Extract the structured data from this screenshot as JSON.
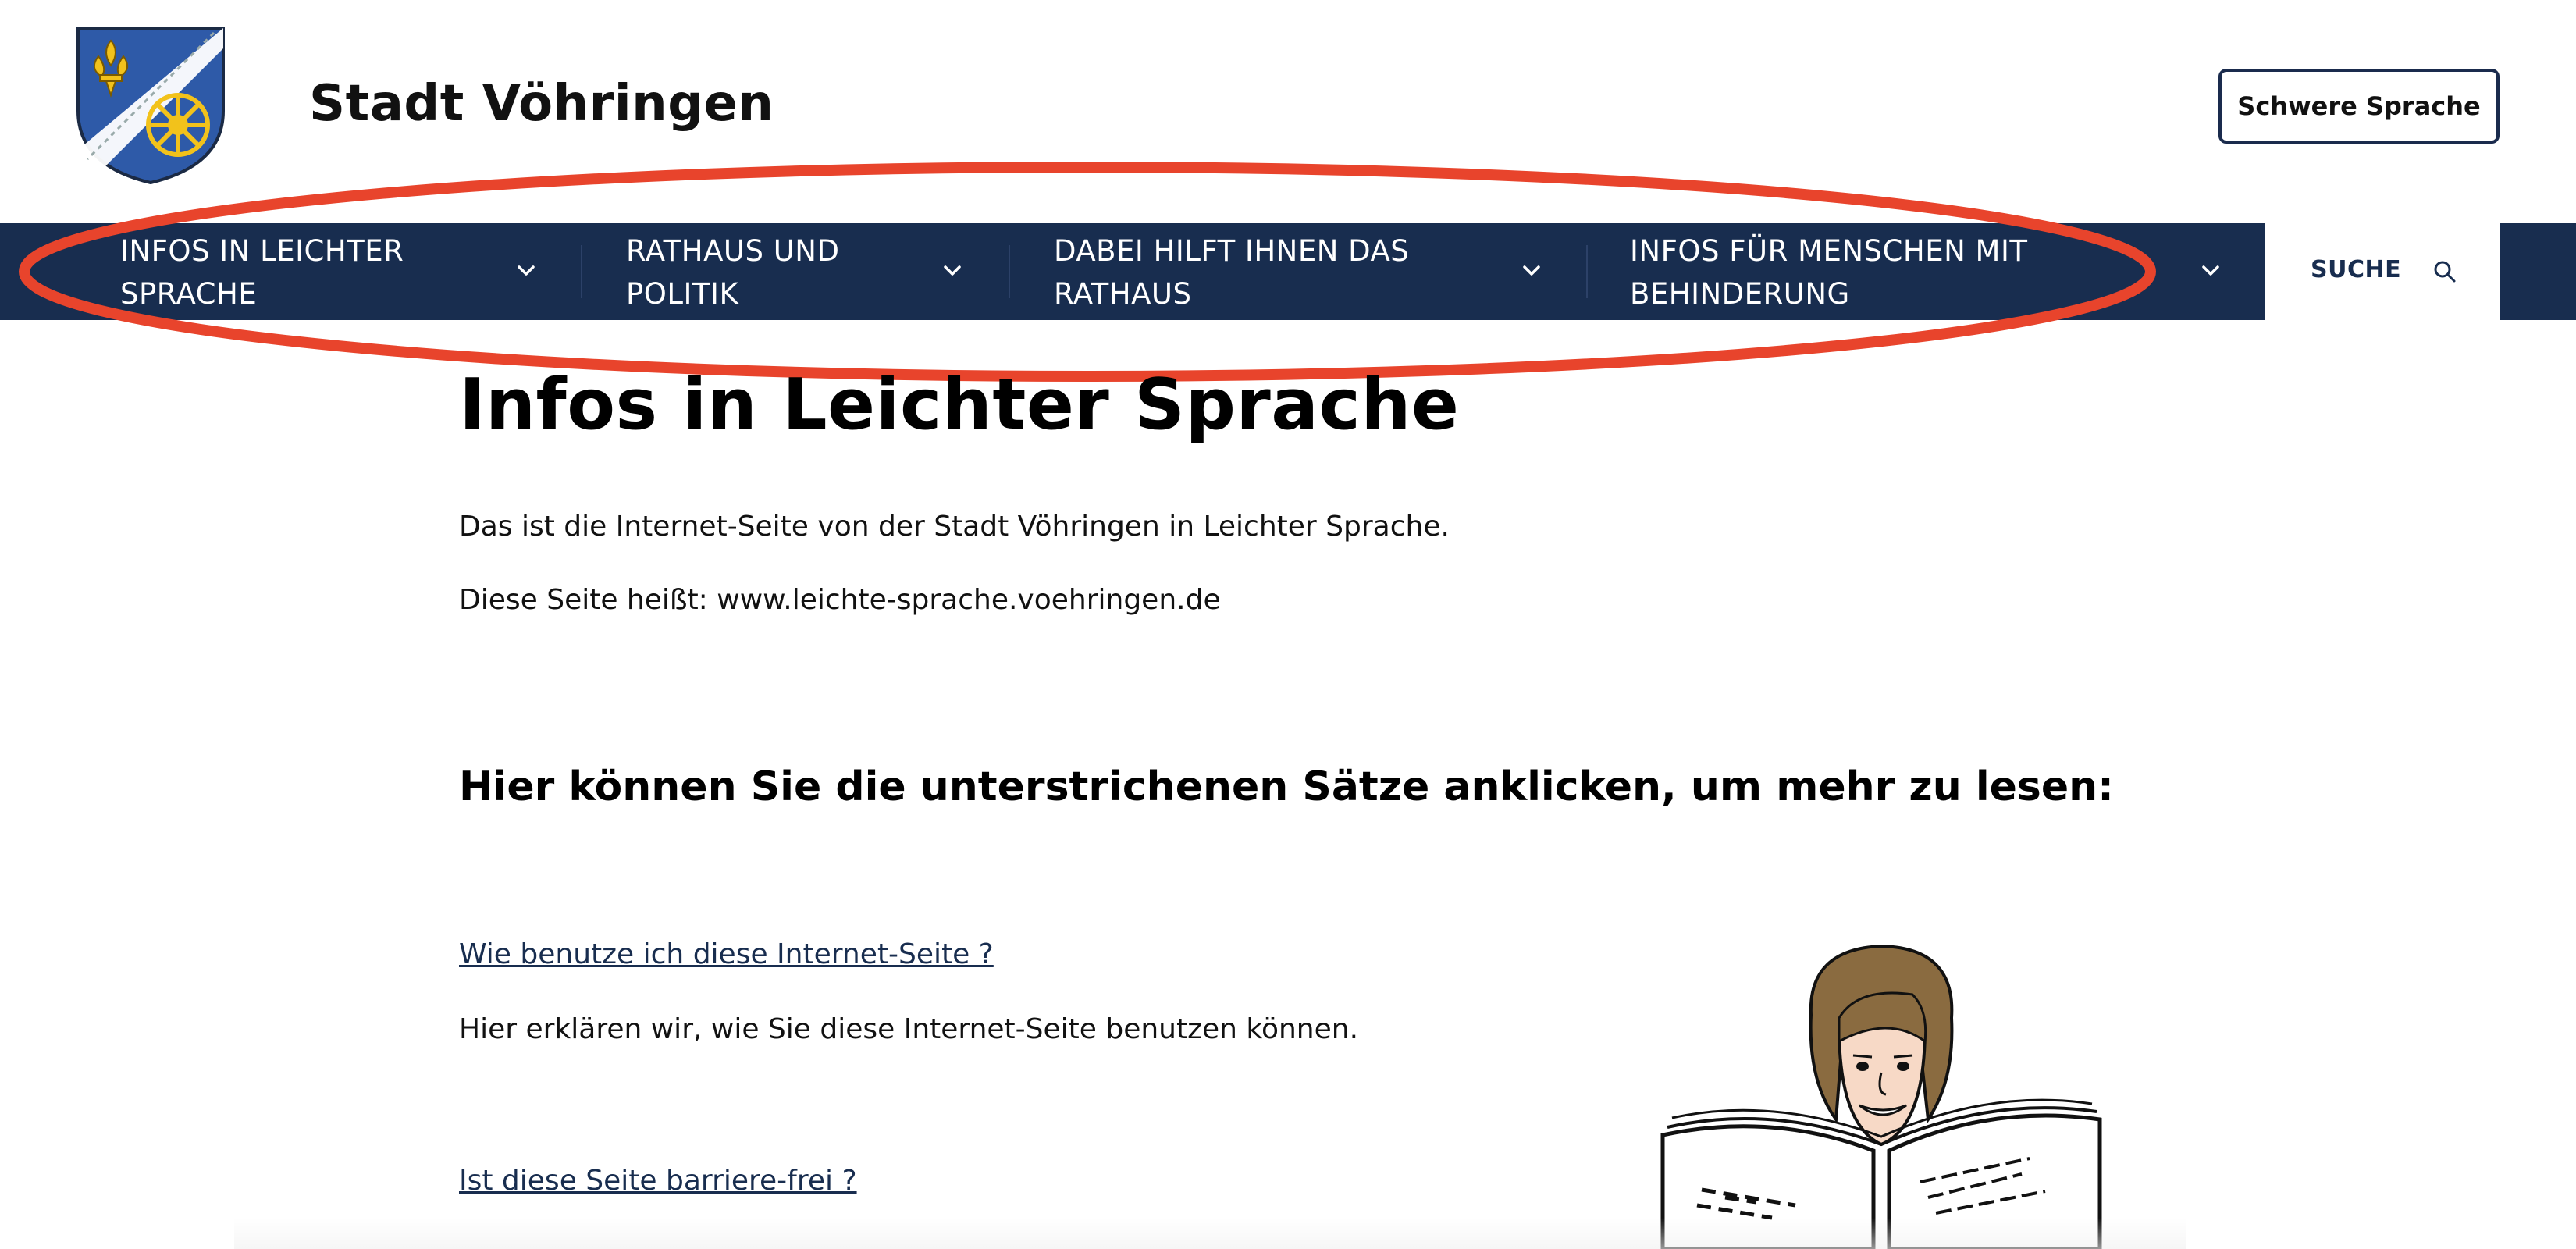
{
  "header": {
    "site_title": "Stadt Vöhringen",
    "easy_button_label": "Schwere Sprache"
  },
  "nav": {
    "items": [
      {
        "line1": "INFOS IN LEICHTER",
        "line2": "SPRACHE"
      },
      {
        "line1": "RATHAUS UND",
        "line2": "POLITIK"
      },
      {
        "line1": "DABEI HILFT IHNEN DAS",
        "line2": "RATHAUS"
      },
      {
        "line1": "INFOS FÜR MENSCHEN MIT",
        "line2": "BEHINDERUNG"
      }
    ],
    "search_label": "SUCHE"
  },
  "main": {
    "title": "Infos in Leichter Sprache",
    "intro1": "Das ist die Internet-Seite von der Stadt Vöhringen in Leichter Sprache.",
    "intro2": "Diese Seite heißt: www.leichte-sprache.voehringen.de",
    "subheading": "Hier können Sie die unterstrichenen Sätze anklicken, um mehr zu lesen:",
    "links": [
      {
        "label": "Wie benutze ich diese Internet-Seite ?",
        "desc": "Hier erklären wir, wie Sie diese Internet-Seite benutzen können."
      },
      {
        "label": "Ist diese Seite barriere-frei ?",
        "desc": ""
      }
    ]
  },
  "colors": {
    "nav_bg": "#182d4f",
    "accent_ellipse": "#e8442c",
    "crest_blue": "#2e5aa8",
    "crest_gold": "#f2c21b"
  }
}
